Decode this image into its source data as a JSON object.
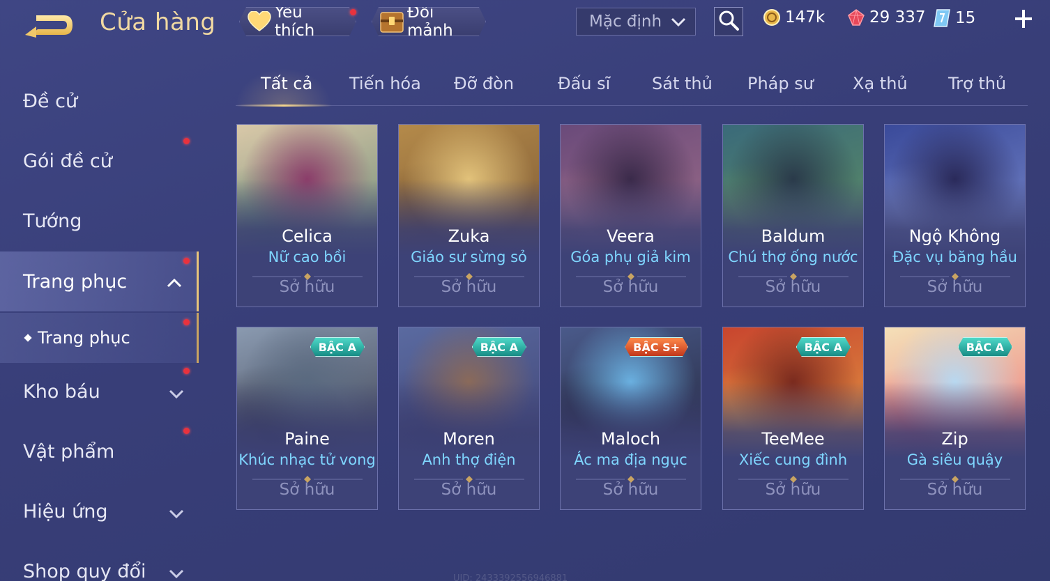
{
  "header": {
    "title": "Cửa hàng",
    "favorites_label": "Yêu thích",
    "exchange_label": "Đổi mảnh",
    "sort": {
      "selected": "Mặc định"
    },
    "currencies": [
      {
        "icon": "gold-coin-icon",
        "value": "147k"
      },
      {
        "icon": "ruby-gem-icon",
        "value": "29 337"
      },
      {
        "icon": "voucher-icon",
        "value": "15"
      }
    ]
  },
  "sidebar": {
    "items": [
      {
        "label": "Đề cử",
        "badge": false
      },
      {
        "label": "Gói đề cử",
        "badge": true
      },
      {
        "label": "Tướng",
        "badge": false
      },
      {
        "label": "Trang phục",
        "badge": true,
        "active": true,
        "expanded": true
      },
      {
        "label": "Trang phục",
        "badge": true,
        "sub": true,
        "active": true
      },
      {
        "label": "Kho báu",
        "badge": true
      },
      {
        "label": "Vật phẩm",
        "badge": true
      },
      {
        "label": "Hiệu ứng",
        "badge": false
      },
      {
        "label": "Shop quy đổi",
        "badge": false
      }
    ]
  },
  "tabs": [
    {
      "label": "Tất cả",
      "active": true
    },
    {
      "label": "Tiến hóa"
    },
    {
      "label": "Đỡ đòn"
    },
    {
      "label": "Đấu sĩ"
    },
    {
      "label": "Sát thủ"
    },
    {
      "label": "Pháp sư"
    },
    {
      "label": "Xạ thủ"
    },
    {
      "label": "Trợ thủ"
    }
  ],
  "cards": [
    {
      "hero": "Celica",
      "skin": "Nữ cao bồi",
      "status": "Sở hữu",
      "tier": "",
      "colors": [
        "#d9c8a8",
        "#4e7a6a",
        "#8b3d6a"
      ]
    },
    {
      "hero": "Zuka",
      "skin": "Giáo sư sừng sỏ",
      "status": "Sở hữu",
      "tier": "",
      "colors": [
        "#b48a4a",
        "#6b4a2e",
        "#e2c27a"
      ]
    },
    {
      "hero": "Veera",
      "skin": "Góa phụ giả kim",
      "status": "Sở hữu",
      "tier": "",
      "colors": [
        "#6a4a7a",
        "#b07a8e",
        "#3a2a4a"
      ]
    },
    {
      "hero": "Baldum",
      "skin": "Chú thợ ống nước",
      "status": "Sở hữu",
      "tier": "",
      "colors": [
        "#3a6a7a",
        "#6a9a5a",
        "#2a3a4a"
      ]
    },
    {
      "hero": "Ngộ Không",
      "skin": "Đặc vụ băng hầu",
      "status": "Sở hữu",
      "tier": "",
      "colors": [
        "#3a4a9a",
        "#8a9ad8",
        "#2a2a5a"
      ]
    },
    {
      "hero": "Paine",
      "skin": "Khúc nhạc tử vong",
      "status": "Sở hữu",
      "tier": "BẬC A",
      "colors": [
        "#8a9ab0",
        "#2a2a3a",
        "#5a6a80"
      ]
    },
    {
      "hero": "Moren",
      "skin": "Anh thợ điện",
      "status": "Sở hữu",
      "tier": "BẬC A",
      "colors": [
        "#5a6aa0",
        "#3a3a6a",
        "#8a6a5a"
      ]
    },
    {
      "hero": "Maloch",
      "skin": "Ác ma địa ngục",
      "status": "Sở hữu",
      "tier": "BẬC S+",
      "colors": [
        "#4a5a8a",
        "#1a1a2a",
        "#6ab0e0"
      ]
    },
    {
      "hero": "TeeMee",
      "skin": "Xiếc cung đình",
      "status": "Sở hữu",
      "tier": "BẬC A",
      "colors": [
        "#c8452e",
        "#e8b04a",
        "#7a2a1e"
      ]
    },
    {
      "hero": "Zip",
      "skin": "Gà siêu quậy",
      "status": "Sở hữu",
      "tier": "BẬC A",
      "colors": [
        "#f4e0b8",
        "#e85a6a",
        "#b8d8f0"
      ]
    }
  ],
  "footer": {
    "uid": "UID: 2433392556946881"
  }
}
